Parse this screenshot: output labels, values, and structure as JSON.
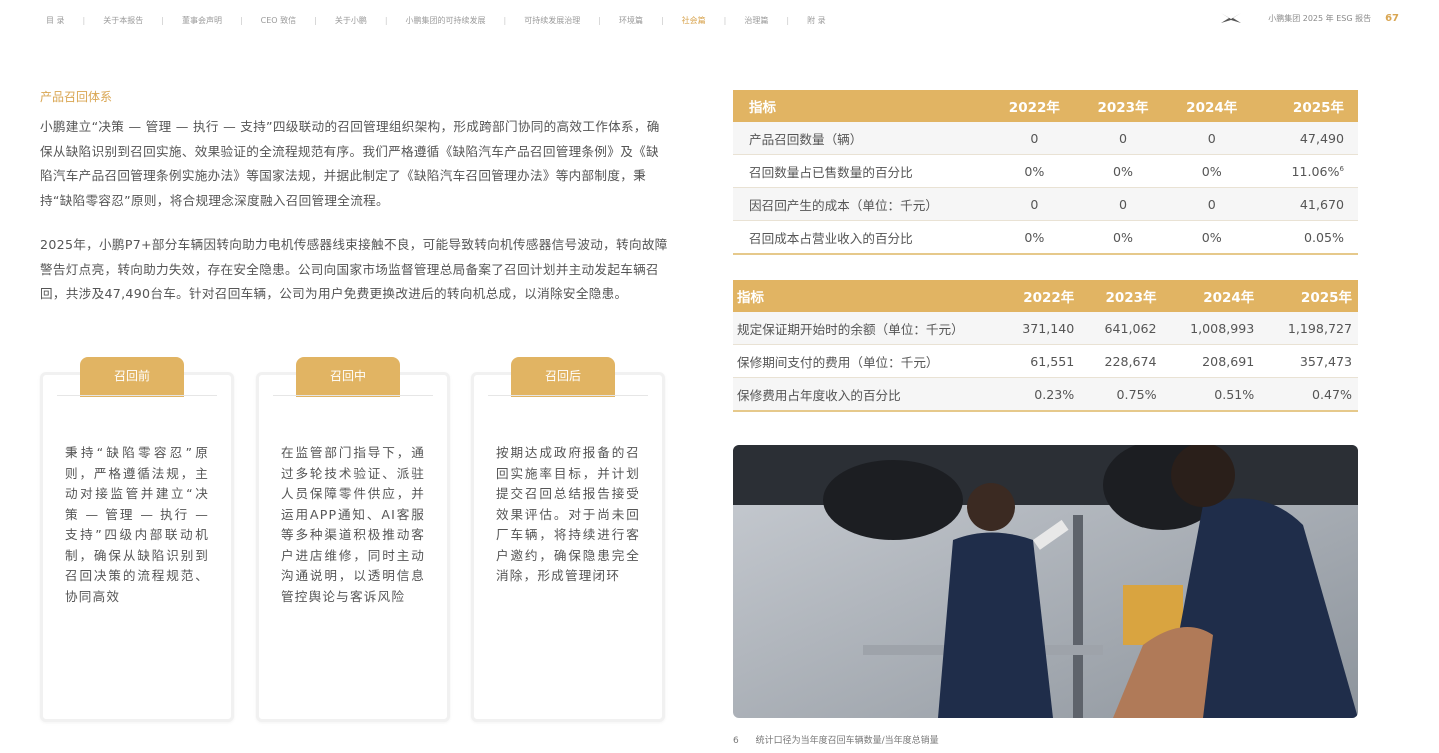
{
  "nav": {
    "items": [
      "目 录",
      "关于本报告",
      "董事会声明",
      "CEO 致信",
      "关于小鹏",
      "小鹏集团的可持续发展",
      "可持续发展治理",
      "环境篇",
      "社会篇",
      "治理篇",
      "附 录"
    ],
    "active_index": 8,
    "report_title": "小鹏集团 2025 年 ESG 报告",
    "page_number": "67",
    "logo_icon": "xpeng-logo-icon"
  },
  "main": {
    "section_title": "产品召回体系",
    "paragraph1": "小鹏建立“决策 — 管理 — 执行 — 支持”四级联动的召回管理组织架构，形成跨部门协同的高效工作体系，确保从缺陷识别到召回实施、效果验证的全流程规范有序。我们严格遵循《缺陷汽车产品召回管理条例》及《缺陷汽车产品召回管理条例实施办法》等国家法规，并据此制定了《缺陷汽车召回管理办法》等内部制度，秉持“缺陷零容忍”原则，将合规理念深度融入召回管理全流程。",
    "paragraph2": "2025年，小鹏P7+部分车辆因转向助力电机传感器线束接触不良，可能导致转向机传感器信号波动，转向故障警告灯点亮，转向助力失效，存在安全隐患。公司向国家市场监督管理总局备案了召回计划并主动发起车辆召回，共涉及47,490台车。针对召回车辆，公司为用户免费更换改进后的转向机总成，以消除安全隐患。",
    "cards": [
      {
        "label": "召回前",
        "text": "秉持“缺陷零容忍”原则，严格遵循法规，主动对接监管并建立“决策 — 管理 — 执行 — 支持”四级内部联动机制，确保从缺陷识别到召回决策的流程规范、协同高效"
      },
      {
        "label": "召回中",
        "text": "在监管部门指导下，通过多轮技术验证、派驻人员保障零件供应，并运用APP通知、AI客服等多种渠道积极推动客户进店维修，同时主动沟通说明，以透明信息管控舆论与客诉风险"
      },
      {
        "label": "召回后",
        "text": "按期达成政府报备的召回实施率目标，并计划提交召回总结报告接受效果评估。对于尚未回厂车辆，将持续进行客户邀约，确保隐患完全消除，形成管理闭环"
      }
    ]
  },
  "table1": {
    "headers": [
      "指标",
      "2022年",
      "2023年",
      "2024年",
      "2025年"
    ],
    "rows": [
      [
        "产品召回数量（辆）",
        "0",
        "0",
        "0",
        "47,490"
      ],
      [
        "召回数量占已售数量的百分比",
        "0%",
        "0%",
        "0%",
        "11.06%"
      ],
      [
        "因召回产生的成本（单位：千元）",
        "0",
        "0",
        "0",
        "41,670"
      ],
      [
        "召回成本占营业收入的百分比",
        "0%",
        "0%",
        "0%",
        "0.05%"
      ]
    ],
    "footnote_marker": "6"
  },
  "table2": {
    "headers": [
      "指标",
      "2022年",
      "2023年",
      "2024年",
      "2025年"
    ],
    "rows": [
      [
        "规定保证期开始时的余额（单位：千元）",
        "371,140",
        "641,062",
        "1,008,993",
        "1,198,727"
      ],
      [
        "保修期间支付的费用（单位：千元）",
        "61,551",
        "228,674",
        "208,691",
        "357,473"
      ],
      [
        "保修费用占年度收入的百分比",
        "0.23%",
        "0.75%",
        "0.51%",
        "0.47%"
      ]
    ]
  },
  "footnote": {
    "number": "6",
    "text": "统计口径为当年度召回车辆数量/当年度总销量"
  },
  "colors": {
    "accent": "#e1b463",
    "accent_text": "#d9a652",
    "body_text": "#555555"
  }
}
